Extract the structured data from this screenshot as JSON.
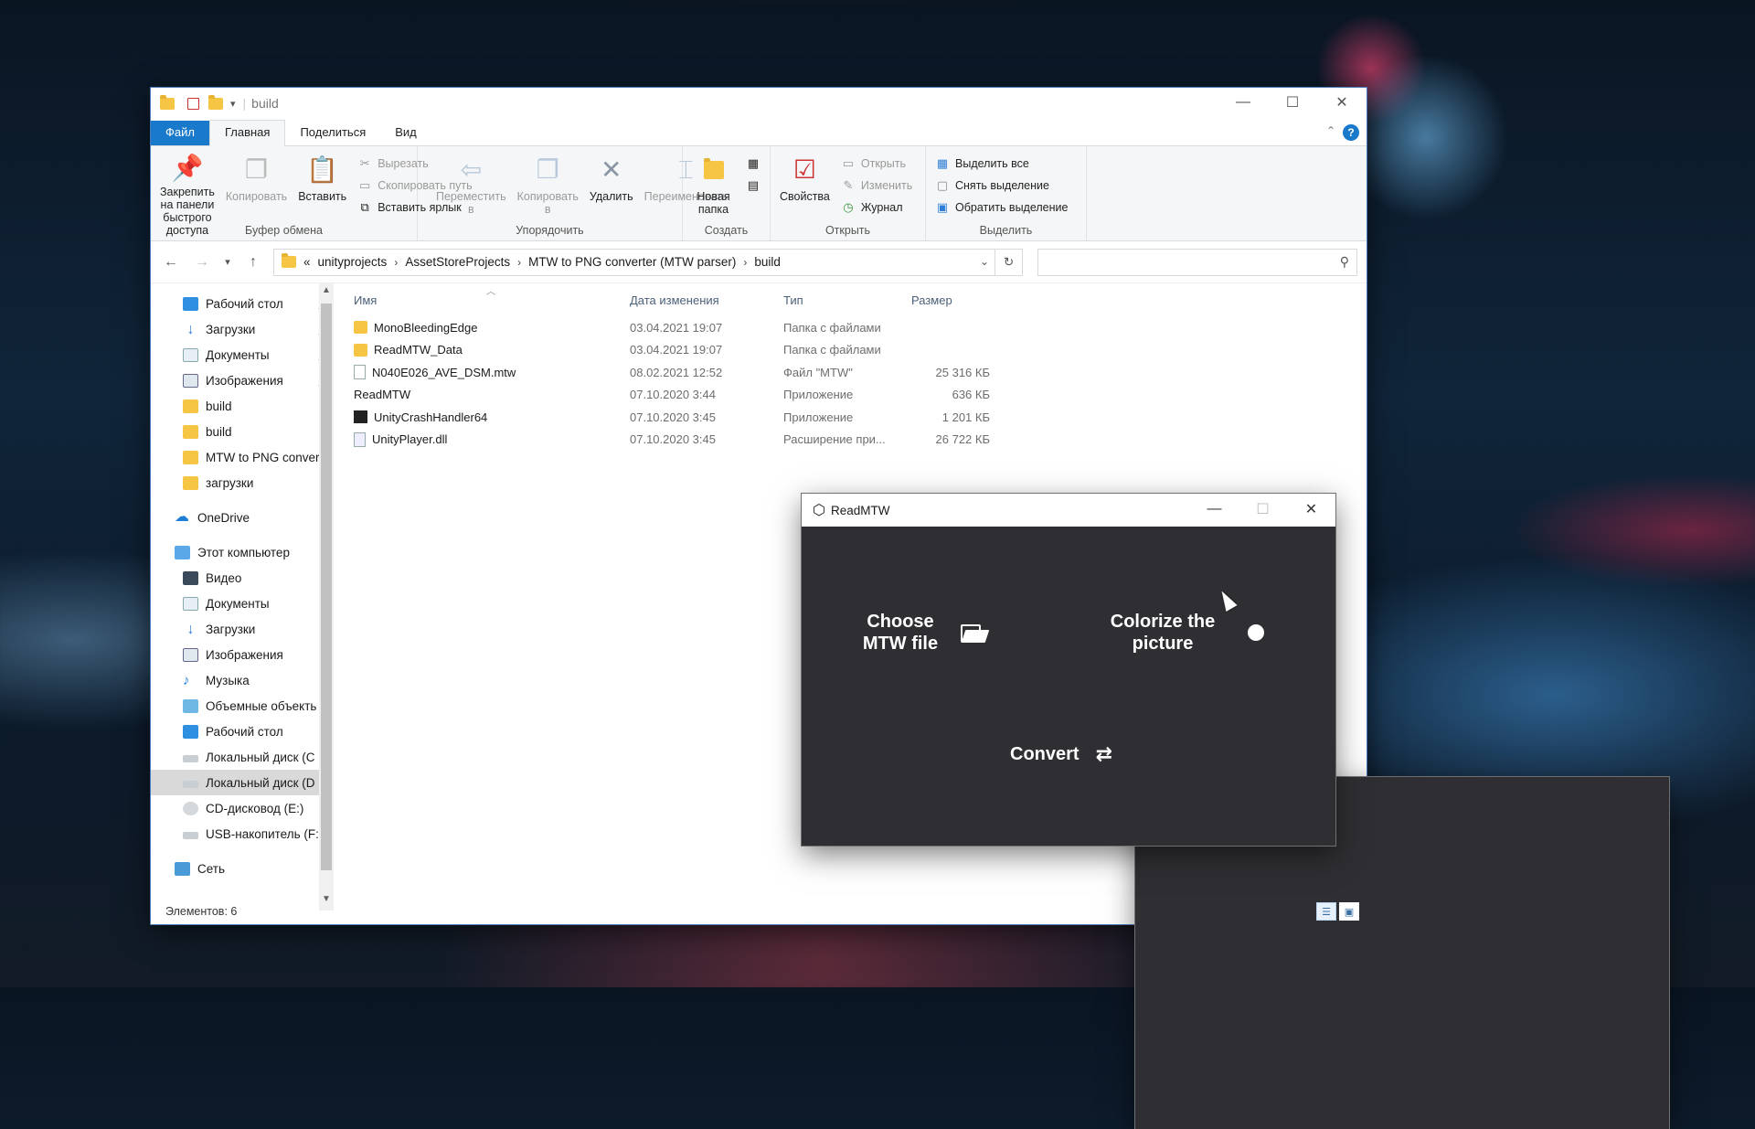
{
  "explorer": {
    "title": "build",
    "tabs": {
      "file": "Файл",
      "home": "Главная",
      "share": "Поделиться",
      "view": "Вид"
    },
    "ribbon": {
      "clipboard": {
        "label": "Буфер обмена",
        "pin": "Закрепить на панели быстрого доступа",
        "copy": "Копировать",
        "paste": "Вставить",
        "cut": "Вырезать",
        "copy_path": "Скопировать путь",
        "paste_shortcut": "Вставить ярлык"
      },
      "organize": {
        "label": "Упорядочить",
        "move": "Переместить в",
        "copy_to": "Копировать в",
        "delete": "Удалить",
        "rename": "Переименовать"
      },
      "create": {
        "label": "Создать",
        "new_folder": "Новая папка"
      },
      "open": {
        "label": "Открыть",
        "properties": "Свойства",
        "open": "Открыть",
        "edit": "Изменить",
        "history": "Журнал"
      },
      "select": {
        "label": "Выделить",
        "select_all": "Выделить все",
        "select_none": "Снять выделение",
        "invert": "Обратить выделение"
      }
    },
    "address": {
      "prefix": "«",
      "crumbs": [
        "unityprojects",
        "AssetStoreProjects",
        "MTW to PNG converter (MTW parser)",
        "build"
      ]
    },
    "search_placeholder": "",
    "sidebar": [
      {
        "label": "Рабочий стол",
        "icon": "desktop-icon",
        "pinned": true
      },
      {
        "label": "Загрузки",
        "icon": "download-icon",
        "pinned": true
      },
      {
        "label": "Документы",
        "icon": "documents-icon",
        "pinned": true
      },
      {
        "label": "Изображения",
        "icon": "pictures-icon",
        "pinned": true
      },
      {
        "label": "build",
        "icon": "folder-icon"
      },
      {
        "label": "build",
        "icon": "folder-icon"
      },
      {
        "label": "MTW to PNG conver",
        "icon": "folder-icon"
      },
      {
        "label": "загрузки",
        "icon": "folder-icon"
      },
      {
        "label": "OneDrive",
        "icon": "onedrive-icon"
      },
      {
        "label": "Этот компьютер",
        "icon": "computer-icon"
      },
      {
        "label": "Видео",
        "icon": "video-icon"
      },
      {
        "label": "Документы",
        "icon": "documents-icon"
      },
      {
        "label": "Загрузки",
        "icon": "download-icon"
      },
      {
        "label": "Изображения",
        "icon": "pictures-icon"
      },
      {
        "label": "Музыка",
        "icon": "music-icon"
      },
      {
        "label": "Объемные объекть",
        "icon": "3d-objects-icon"
      },
      {
        "label": "Рабочий стол",
        "icon": "desktop-icon"
      },
      {
        "label": "Локальный диск (C",
        "icon": "drive-icon"
      },
      {
        "label": "Локальный диск (D",
        "icon": "drive-icon"
      },
      {
        "label": "CD-дисковод (E:)",
        "icon": "cd-drive-icon"
      },
      {
        "label": "USB-накопитель (F:",
        "icon": "usb-drive-icon"
      },
      {
        "label": "Сеть",
        "icon": "network-icon"
      }
    ],
    "columns": {
      "name": "Имя",
      "date": "Дата изменения",
      "type": "Тип",
      "size": "Размер"
    },
    "files": [
      {
        "name": "MonoBleedingEdge",
        "date": "03.04.2021 19:07",
        "type": "Папка с файлами",
        "size": "",
        "icon": "folder-icon"
      },
      {
        "name": "ReadMTW_Data",
        "date": "03.04.2021 19:07",
        "type": "Папка с файлами",
        "size": "",
        "icon": "folder-icon"
      },
      {
        "name": "N040E026_AVE_DSM.mtw",
        "date": "08.02.2021 12:52",
        "type": "Файл \"MTW\"",
        "size": "25 316 КБ",
        "icon": "file-icon"
      },
      {
        "name": "ReadMTW",
        "date": "07.10.2020 3:44",
        "type": "Приложение",
        "size": "636 КБ",
        "icon": "unity-app-icon"
      },
      {
        "name": "UnityCrashHandler64",
        "date": "07.10.2020 3:45",
        "type": "Приложение",
        "size": "1 201 КБ",
        "icon": "crash-handler-icon"
      },
      {
        "name": "UnityPlayer.dll",
        "date": "07.10.2020 3:45",
        "type": "Расширение при...",
        "size": "26 722 КБ",
        "icon": "dll-icon"
      }
    ],
    "status": "Элементов: 6"
  },
  "app": {
    "title": "ReadMTW",
    "choose_line1": "Choose",
    "choose_line2": "MTW file",
    "colorize_line1": "Colorize the",
    "colorize_line2": "picture",
    "convert": "Convert"
  }
}
